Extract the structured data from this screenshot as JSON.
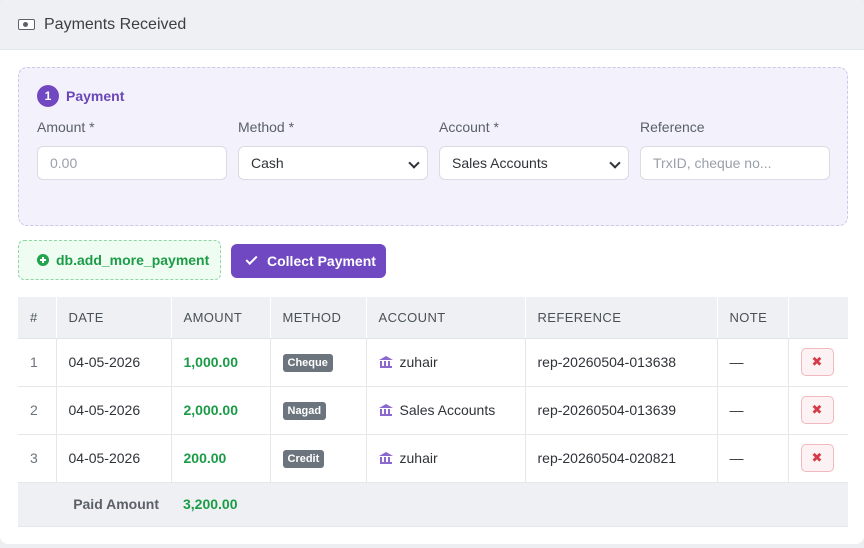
{
  "header": {
    "title": "Payments Received",
    "icon": "money-icon"
  },
  "payment_form": {
    "step_number": "1",
    "step_label": "Payment",
    "fields": {
      "amount": {
        "label": "Amount *",
        "placeholder": "0.00"
      },
      "method": {
        "label": "Method *",
        "value": "Cash"
      },
      "account": {
        "label": "Account *",
        "value": "Sales Accounts"
      },
      "reference": {
        "label": "Reference",
        "placeholder": "TrxID, cheque no..."
      }
    }
  },
  "actions": {
    "add_more_label": "db.add_more_payment",
    "collect_label": "Collect Payment"
  },
  "table": {
    "headers": [
      "#",
      "DATE",
      "AMOUNT",
      "METHOD",
      "ACCOUNT",
      "REFERENCE",
      "NOTE",
      ""
    ],
    "rows": [
      {
        "num": "1",
        "date": "04-05-2026",
        "amount": "1,000.00",
        "method": "Cheque",
        "account": "zuhair",
        "reference": "rep-20260504-013638",
        "note": "—",
        "delete": "✖"
      },
      {
        "num": "2",
        "date": "04-05-2026",
        "amount": "2,000.00",
        "method": "Nagad",
        "account": "Sales Accounts",
        "reference": "rep-20260504-013639",
        "note": "—",
        "delete": "✖"
      },
      {
        "num": "3",
        "date": "04-05-2026",
        "amount": "200.00",
        "method": "Credit",
        "account": "zuhair",
        "reference": "rep-20260504-020821",
        "note": "—",
        "delete": "✖"
      }
    ],
    "total_label": "Paid Amount",
    "total_value": "3,200.00"
  },
  "colors": {
    "accent": "#7048c2",
    "success": "#1a9c46",
    "danger": "#d63a48"
  }
}
